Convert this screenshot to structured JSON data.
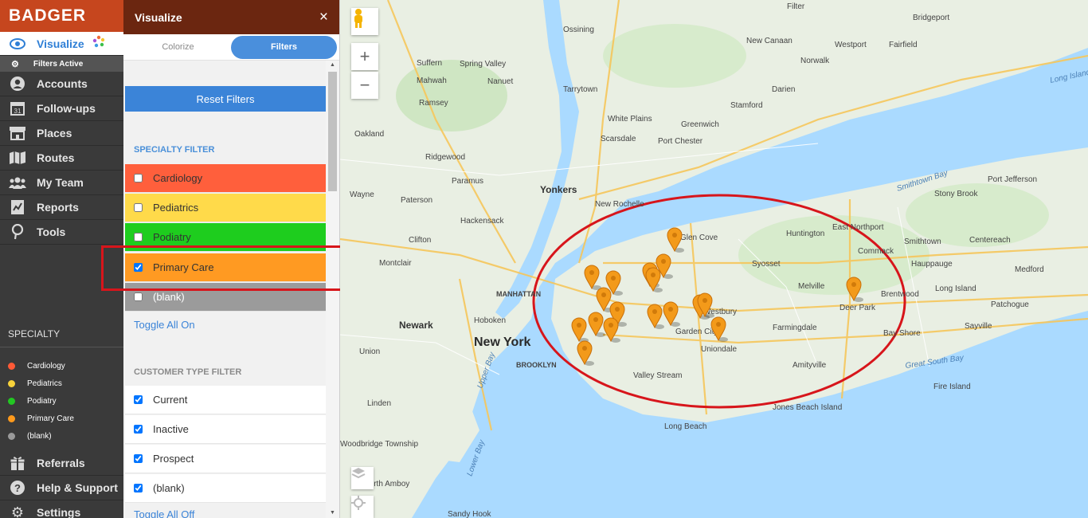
{
  "app": {
    "brand": "BADGER"
  },
  "nav": {
    "visualize": "Visualize",
    "filters_active": "Filters Active",
    "items": [
      {
        "label": "Accounts",
        "icon": "user-circle-icon"
      },
      {
        "label": "Follow-ups",
        "icon": "calendar-icon"
      },
      {
        "label": "Places",
        "icon": "store-icon"
      },
      {
        "label": "Routes",
        "icon": "map-icon"
      },
      {
        "label": "My Team",
        "icon": "team-icon"
      },
      {
        "label": "Reports",
        "icon": "report-icon"
      },
      {
        "label": "Tools",
        "icon": "pin-icon"
      }
    ],
    "bottom_items": [
      {
        "label": "Referrals",
        "icon": "gift-icon"
      },
      {
        "label": "Help & Support",
        "icon": "help-icon"
      },
      {
        "label": "Settings",
        "icon": "gear-icon"
      }
    ]
  },
  "legend": {
    "title": "SPECIALTY",
    "items": [
      {
        "label": "Cardiology",
        "color": "#ff5a36"
      },
      {
        "label": "Pediatrics",
        "color": "#f7d23b"
      },
      {
        "label": "Podiatry",
        "color": "#22c722"
      },
      {
        "label": "Primary Care",
        "color": "#ff9a1c"
      },
      {
        "label": "(blank)",
        "color": "#9a9a9a"
      }
    ]
  },
  "panel": {
    "title": "Visualize",
    "close": "×",
    "tabs": {
      "colorize": "Colorize",
      "filters": "Filters"
    },
    "reset": "Reset Filters",
    "specialty_title": "SPECIALTY FILTER",
    "specialty_rows": [
      {
        "label": "Cardiology",
        "checked": false,
        "color": "#ff5f3c"
      },
      {
        "label": "Pediatrics",
        "checked": false,
        "color": "#ffda4a"
      },
      {
        "label": "Podiatry",
        "checked": false,
        "color": "#1ecd1e"
      },
      {
        "label": "Primary Care",
        "checked": true,
        "color": "#ff9a22"
      },
      {
        "label": "(blank)",
        "checked": false,
        "color": "#9b9b9b"
      }
    ],
    "toggle_all_on": "Toggle All On",
    "customer_title": "CUSTOMER TYPE FILTER",
    "customer_rows": [
      {
        "label": "Current",
        "checked": true
      },
      {
        "label": "Inactive",
        "checked": true
      },
      {
        "label": "Prospect",
        "checked": true
      },
      {
        "label": "(blank)",
        "checked": true
      }
    ],
    "toggle_all_off": "Toggle All Off"
  },
  "map": {
    "labels": [
      "New York",
      "Newark",
      "Yonkers",
      "Hoboken",
      "MANHATTAN",
      "BROOKLYN",
      "Bridgeport",
      "Westport",
      "Fairfield",
      "Norwalk",
      "Darien",
      "New Canaan",
      "Stamford",
      "Greenwich",
      "Port Chester",
      "White Plains",
      "Scarsdale",
      "Tarrytown",
      "Ossining",
      "Suffern",
      "Spring Valley",
      "Nanuet",
      "Mahwah",
      "Ramsey",
      "Oakland",
      "Ridgewood",
      "Paramus",
      "Wayne",
      "Paterson",
      "Hackensack",
      "Clifton",
      "Montclair",
      "Union",
      "Linden",
      "Woodbridge Township",
      "New Rochelle",
      "Glen Cove",
      "Huntington",
      "East Northport",
      "Smithtown",
      "Stony Brook",
      "Port Jefferson",
      "Centereach",
      "Commack",
      "Hauppauge",
      "Medford",
      "Syosset",
      "Melville",
      "Brentwood",
      "Deer Park",
      "Bay Shore",
      "Long Island",
      "Patchogue",
      "Sayville",
      "Westbury",
      "Garden City",
      "Uniondale",
      "Farmingdale",
      "Amityville",
      "Valley Stream",
      "Long Beach",
      "Jones Beach Island",
      "Fire Island",
      "Perth Amboy",
      "Filter",
      "Smithtown Bay",
      "Great South Bay",
      "Long Island Sound",
      "Upper Bay",
      "Lower Bay",
      "Sandy Hook"
    ]
  }
}
